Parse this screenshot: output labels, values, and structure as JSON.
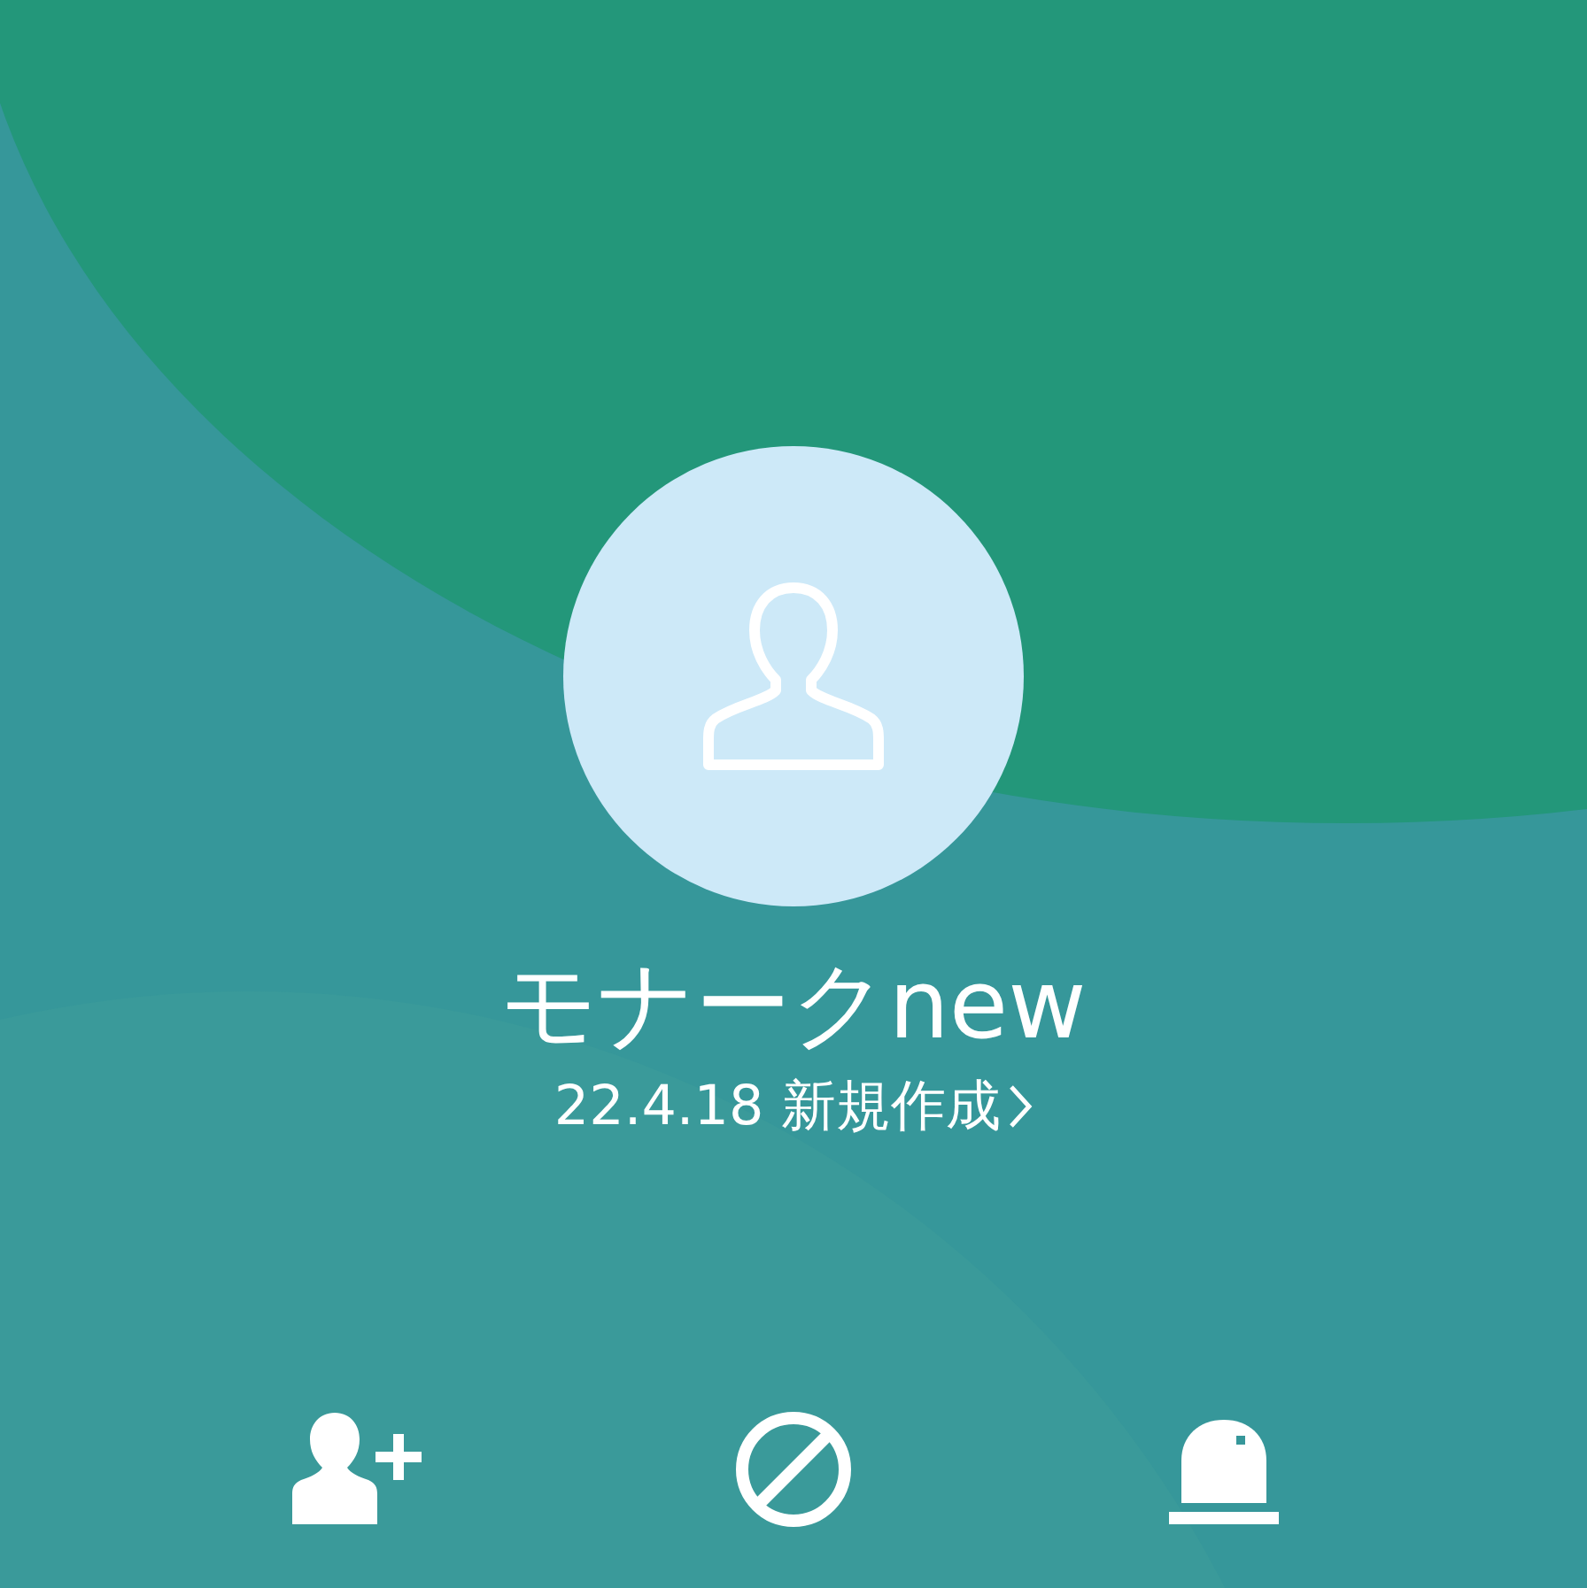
{
  "profile": {
    "name": "モナークnew",
    "status": "22.4.18 新規作成"
  },
  "actions": [
    {
      "kind": "add-friend"
    },
    {
      "kind": "block"
    },
    {
      "kind": "siren"
    }
  ]
}
